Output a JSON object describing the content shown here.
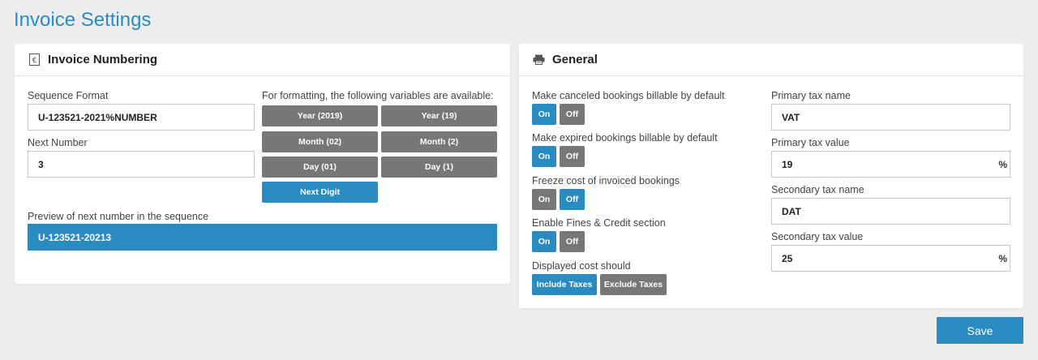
{
  "page": {
    "title": "Invoice Settings"
  },
  "numbering": {
    "title": "Invoice Numbering",
    "icon": "euro-document-icon",
    "sequence_format_label": "Sequence Format",
    "sequence_format_value": "U-123521-2021%NUMBER",
    "next_number_label": "Next Number",
    "next_number_value": "3",
    "variables_label": "For formatting, the following variables are available:",
    "variables": [
      "Year (2019)",
      "Year (19)",
      "Month (02)",
      "Month (2)",
      "Day (01)",
      "Day (1)",
      "Next Digit"
    ],
    "preview_label": "Preview of next number in the sequence",
    "preview_value": "U-123521-20213"
  },
  "general": {
    "title": "General",
    "icon": "printer-icon",
    "toggles": [
      {
        "label": "Make canceled bookings billable by default",
        "on": "On",
        "off": "Off",
        "selected": "on"
      },
      {
        "label": "Make expired bookings billable by default",
        "on": "On",
        "off": "Off",
        "selected": "on"
      },
      {
        "label": "Freeze cost of invoiced bookings",
        "on": "On",
        "off": "Off",
        "selected": "off"
      },
      {
        "label": "Enable Fines & Credit section",
        "on": "On",
        "off": "Off",
        "selected": "on"
      }
    ],
    "displayed_cost_label": "Displayed cost should",
    "displayed_cost_options": [
      "Include Taxes",
      "Exclude Taxes"
    ],
    "displayed_cost_selected": "Include Taxes",
    "primary_tax_name_label": "Primary tax name",
    "primary_tax_name_value": "VAT",
    "primary_tax_value_label": "Primary tax value",
    "primary_tax_value_value": "19",
    "secondary_tax_name_label": "Secondary tax name",
    "secondary_tax_name_value": "DAT",
    "secondary_tax_value_label": "Secondary tax value",
    "secondary_tax_value_value": "25",
    "percent_suffix": "%"
  },
  "actions": {
    "save_label": "Save"
  },
  "colors": {
    "accent": "#2a8bc0",
    "inactive": "#777777",
    "background": "#ededf0"
  }
}
